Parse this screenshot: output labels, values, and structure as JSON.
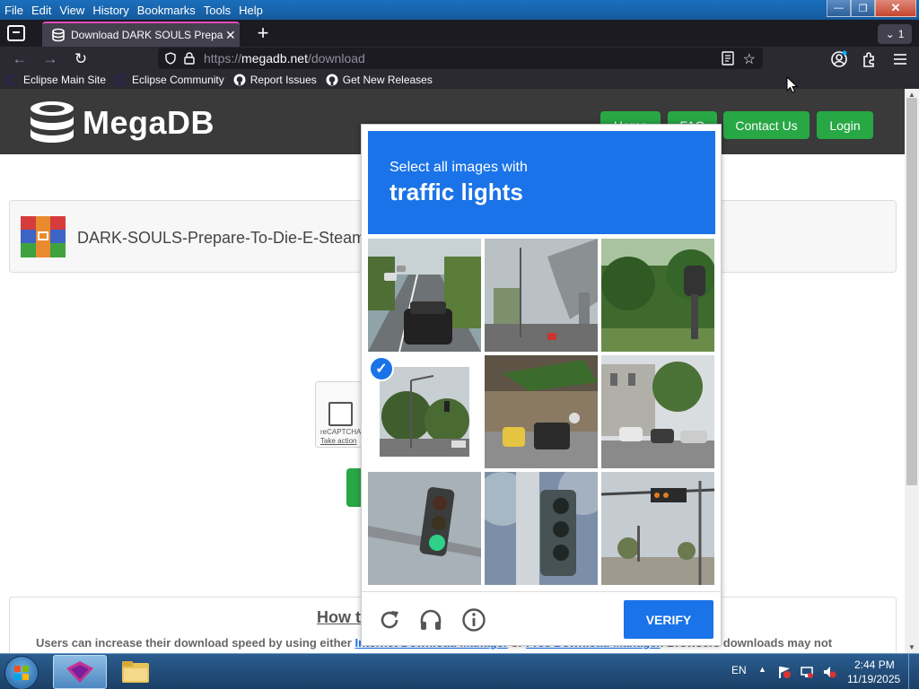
{
  "menubar": {
    "items": [
      "File",
      "Edit",
      "View",
      "History",
      "Bookmarks",
      "Tools",
      "Help"
    ],
    "window_controls": {
      "minimize": "—",
      "maximize": "❐",
      "close": "✕"
    }
  },
  "tabs": {
    "active_title": "Download DARK SOULS Prepare",
    "close_glyph": "✕",
    "new_tab_glyph": "+",
    "tab_count": "1"
  },
  "navbar": {
    "url_prefix": "https://",
    "url_host": "megadb.net",
    "url_path": "/download",
    "back_glyph": "←",
    "forward_glyph": "→",
    "reload_glyph": "↻",
    "star_glyph": "☆"
  },
  "bookmarks": [
    "Eclipse Main Site",
    "Eclipse Community",
    "Report Issues",
    "Get New Releases"
  ],
  "site": {
    "logo_text": "MegaDB",
    "nav": [
      "Home",
      "FAQ",
      "Contact Us",
      "Login"
    ],
    "file_name": "DARK-SOULS-Prepare-To-Die-E-SteamR",
    "recaptcha_label": "reCAPTCHA",
    "recaptcha_action": "Take action",
    "howto_title": "How t",
    "howto_text_1": "Users can increase their download speed by using either ",
    "howto_link_1": "Internet Download Manager",
    "howto_text_2": " or ",
    "howto_link_2": "Free Download Manager",
    "howto_text_3": ". Browsers downloads may not"
  },
  "captcha": {
    "instruction": "Select all images with",
    "target": "traffic lights",
    "verify_label": "VERIFY",
    "selected_tiles": [
      3
    ],
    "icons": [
      "reload-icon",
      "headphones-icon",
      "info-icon"
    ],
    "accent": "#1a73e8"
  },
  "taskbar": {
    "lang": "EN",
    "time": "2:44 PM",
    "date": "11/19/2025"
  },
  "colors": {
    "site_green": "#28a745",
    "site_header": "#3a3a3a",
    "captcha_blue": "#1a73e8"
  }
}
